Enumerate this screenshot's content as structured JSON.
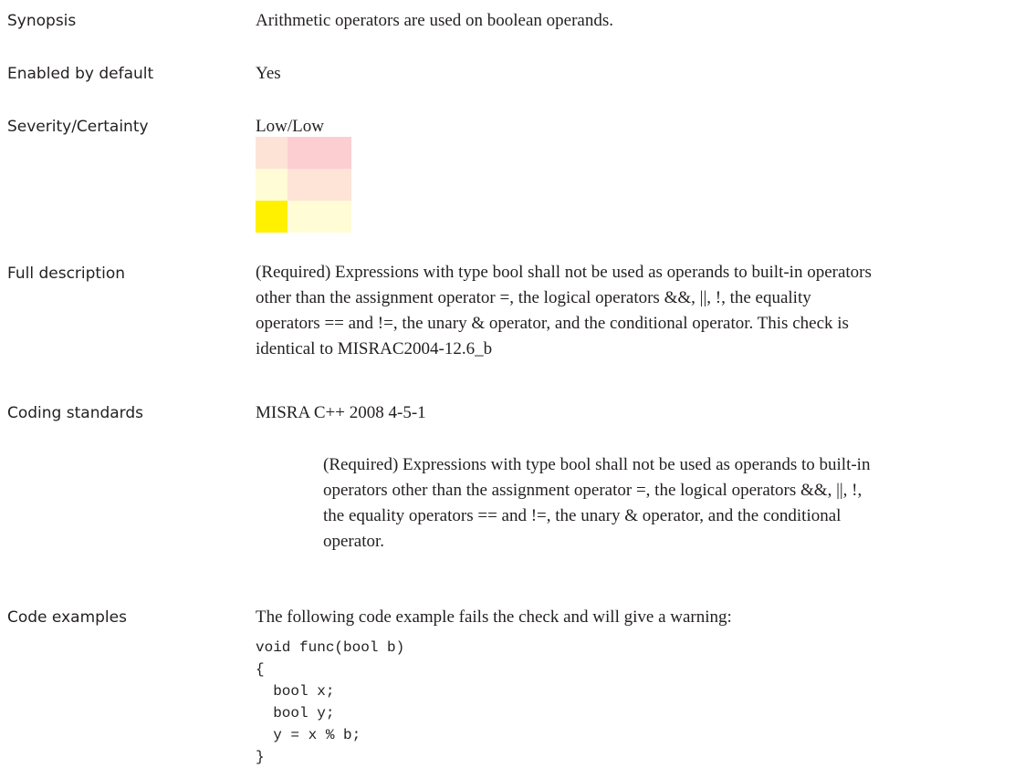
{
  "synopsis": {
    "label": "Synopsis",
    "text": "Arithmetic operators are used on boolean operands."
  },
  "enabled": {
    "label": "Enabled by default",
    "text": "Yes"
  },
  "severity": {
    "label": "Severity/Certainty",
    "text": "Low/Low",
    "grid_colors": [
      "#fde3d6",
      "#fcced2",
      "#fcced2",
      "#fffcd6",
      "#fde4d6",
      "#fde4d6",
      "#fff100",
      "#fffcd6",
      "#fffcd6"
    ]
  },
  "full_description": {
    "label": "Full description",
    "lines": [
      "(Required) Expressions with type bool shall not be used as operands to built-in operators",
      "other than the assignment operator =, the logical operators &&, ||, !, the equality",
      "operators == and !=, the unary & operator, and the conditional operator. This check is",
      "identical to MISRAC2004-12.6_b"
    ]
  },
  "coding_standards": {
    "label": "Coding standards",
    "standard": "MISRA C++ 2008 4-5-1",
    "lines": [
      "(Required) Expressions with type bool shall not be used as operands to built-in",
      "operators other than the assignment operator =, the logical operators &&, ||, !,",
      "the equality operators == and !=, the unary & operator, and the conditional",
      "operator."
    ]
  },
  "code_examples": {
    "label": "Code examples",
    "intro": "The following code example fails the check and will give a warning:",
    "code": "void func(bool b)\n{\n  bool x;\n  bool y;\n  y = x % b;\n}"
  }
}
